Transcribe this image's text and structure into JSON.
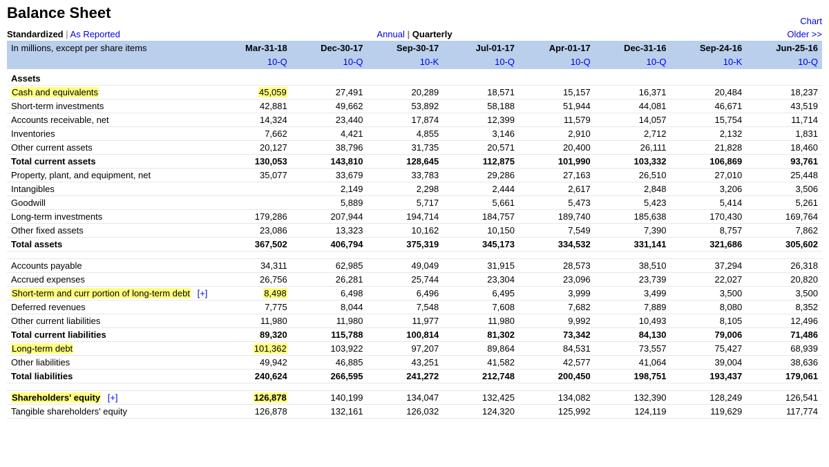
{
  "title": "Balance Sheet",
  "chart_link": "Chart",
  "view_toggle": {
    "standardized": "Standardized",
    "as_reported": "As Reported"
  },
  "period_toggle": {
    "annual": "Annual",
    "quarterly": "Quarterly"
  },
  "older_link": "Older >>",
  "units_label": "In millions, except per share items",
  "periods": [
    "Mar-31-18",
    "Dec-30-17",
    "Sep-30-17",
    "Jul-01-17",
    "Apr-01-17",
    "Dec-31-16",
    "Sep-24-16",
    "Jun-25-16"
  ],
  "filings": [
    "10-Q",
    "10-Q",
    "10-K",
    "10-Q",
    "10-Q",
    "10-Q",
    "10-K",
    "10-Q"
  ],
  "expand_label": "[+]",
  "sections": [
    {
      "type": "section",
      "label": "Assets"
    },
    {
      "type": "row",
      "label": "Cash and equivalents",
      "hl_label": true,
      "hl_first": true,
      "values": [
        "45,059",
        "27,491",
        "20,289",
        "18,571",
        "15,157",
        "16,371",
        "20,484",
        "18,237"
      ]
    },
    {
      "type": "row",
      "label": "Short-term investments",
      "values": [
        "42,881",
        "49,662",
        "53,892",
        "58,188",
        "51,944",
        "44,081",
        "46,671",
        "43,519"
      ]
    },
    {
      "type": "row",
      "label": "Accounts receivable, net",
      "values": [
        "14,324",
        "23,440",
        "17,874",
        "12,399",
        "11,579",
        "14,057",
        "15,754",
        "11,714"
      ]
    },
    {
      "type": "row",
      "label": "Inventories",
      "values": [
        "7,662",
        "4,421",
        "4,855",
        "3,146",
        "2,910",
        "2,712",
        "2,132",
        "1,831"
      ]
    },
    {
      "type": "row",
      "label": "Other current assets",
      "values": [
        "20,127",
        "38,796",
        "31,735",
        "20,571",
        "20,400",
        "26,111",
        "21,828",
        "18,460"
      ]
    },
    {
      "type": "total",
      "label": "Total current assets",
      "values": [
        "130,053",
        "143,810",
        "128,645",
        "112,875",
        "101,990",
        "103,332",
        "106,869",
        "93,761"
      ]
    },
    {
      "type": "row",
      "label": "Property, plant, and equipment, net",
      "values": [
        "35,077",
        "33,679",
        "33,783",
        "29,286",
        "27,163",
        "26,510",
        "27,010",
        "25,448"
      ]
    },
    {
      "type": "row",
      "label": "Intangibles",
      "values": [
        "",
        "2,149",
        "2,298",
        "2,444",
        "2,617",
        "2,848",
        "3,206",
        "3,506"
      ]
    },
    {
      "type": "row",
      "label": "Goodwill",
      "values": [
        "",
        "5,889",
        "5,717",
        "5,661",
        "5,473",
        "5,423",
        "5,414",
        "5,261"
      ]
    },
    {
      "type": "row",
      "label": "Long-term investments",
      "values": [
        "179,286",
        "207,944",
        "194,714",
        "184,757",
        "189,740",
        "185,638",
        "170,430",
        "169,764"
      ]
    },
    {
      "type": "row",
      "label": "Other fixed assets",
      "values": [
        "23,086",
        "13,323",
        "10,162",
        "10,150",
        "7,549",
        "7,390",
        "8,757",
        "7,862"
      ]
    },
    {
      "type": "total",
      "label": "Total assets",
      "values": [
        "367,502",
        "406,794",
        "375,319",
        "345,173",
        "334,532",
        "331,141",
        "321,686",
        "305,602"
      ]
    },
    {
      "type": "spacer"
    },
    {
      "type": "row",
      "label": "Accounts payable",
      "values": [
        "34,311",
        "62,985",
        "49,049",
        "31,915",
        "28,573",
        "38,510",
        "37,294",
        "26,318"
      ]
    },
    {
      "type": "row",
      "label": "Accrued expenses",
      "values": [
        "26,756",
        "26,281",
        "25,744",
        "23,304",
        "23,096",
        "23,739",
        "22,027",
        "20,820"
      ]
    },
    {
      "type": "row",
      "label": "Short-term and curr portion of long-term debt",
      "hl_label": true,
      "hl_first": true,
      "expand": true,
      "values": [
        "8,498",
        "6,498",
        "6,496",
        "6,495",
        "3,999",
        "3,499",
        "3,500",
        "3,500"
      ]
    },
    {
      "type": "row",
      "label": "Deferred revenues",
      "values": [
        "7,775",
        "8,044",
        "7,548",
        "7,608",
        "7,682",
        "7,889",
        "8,080",
        "8,352"
      ]
    },
    {
      "type": "row",
      "label": "Other current liabilities",
      "values": [
        "11,980",
        "11,980",
        "11,977",
        "11,980",
        "9,992",
        "10,493",
        "8,105",
        "12,496"
      ]
    },
    {
      "type": "total",
      "label": "Total current liabilities",
      "values": [
        "89,320",
        "115,788",
        "100,814",
        "81,302",
        "73,342",
        "84,130",
        "79,006",
        "71,486"
      ]
    },
    {
      "type": "row",
      "label": "Long-term debt",
      "hl_label": true,
      "hl_first": true,
      "values": [
        "101,362",
        "103,922",
        "97,207",
        "89,864",
        "84,531",
        "73,557",
        "75,427",
        "68,939"
      ]
    },
    {
      "type": "row",
      "label": "Other liabilities",
      "values": [
        "49,942",
        "46,885",
        "43,251",
        "41,582",
        "42,577",
        "41,064",
        "39,004",
        "38,636"
      ]
    },
    {
      "type": "total",
      "label": "Total liabilities",
      "values": [
        "240,624",
        "266,595",
        "241,272",
        "212,748",
        "200,450",
        "198,751",
        "193,437",
        "179,061"
      ]
    },
    {
      "type": "spacer"
    },
    {
      "type": "row",
      "label": "Shareholders' equity",
      "hl_label": true,
      "hl_first": true,
      "expand": true,
      "bold_label": true,
      "values": [
        "126,878",
        "140,199",
        "134,047",
        "132,425",
        "134,082",
        "132,390",
        "128,249",
        "126,541"
      ]
    },
    {
      "type": "row",
      "label": "Tangible shareholders' equity",
      "values": [
        "126,878",
        "132,161",
        "126,032",
        "124,320",
        "125,992",
        "124,119",
        "119,629",
        "117,774"
      ]
    }
  ]
}
